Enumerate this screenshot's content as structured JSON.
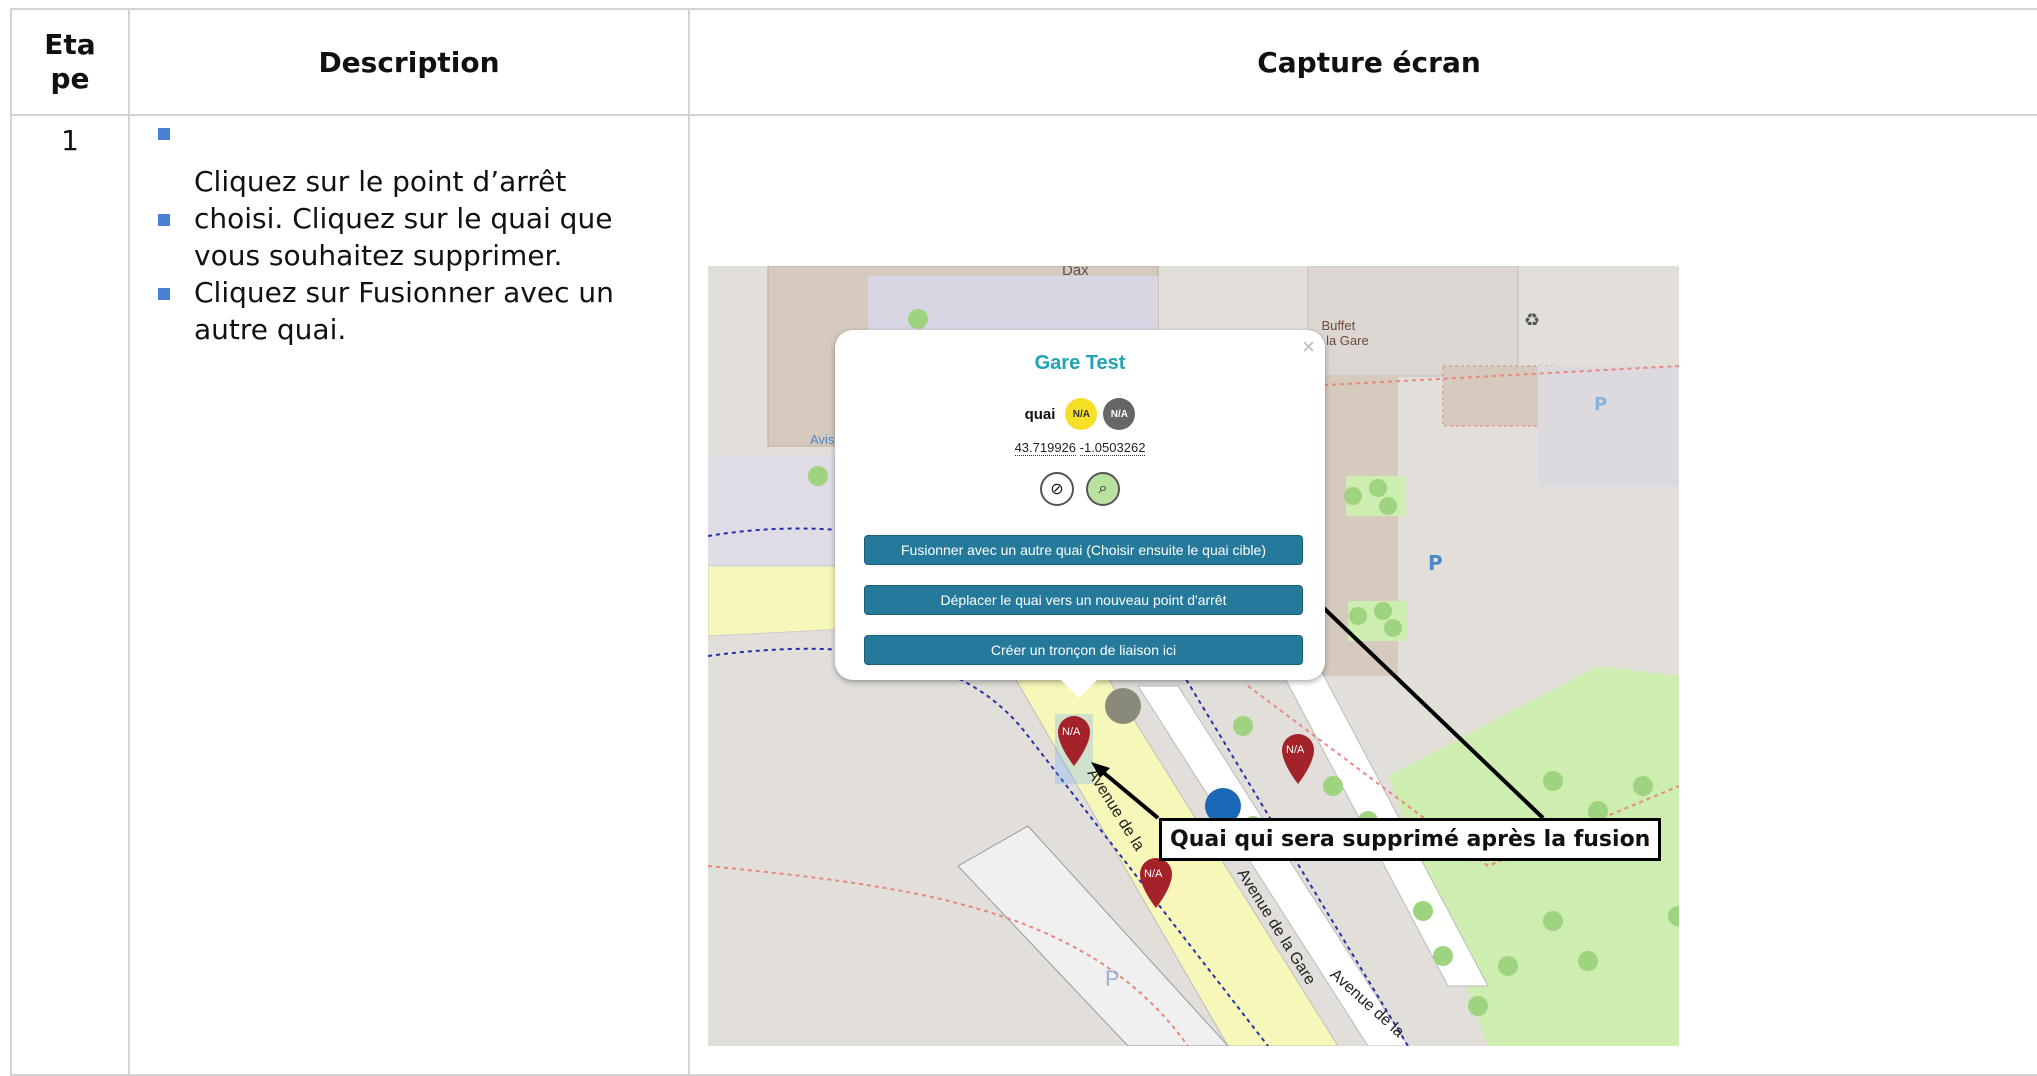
{
  "header": {
    "col_step": "Eta\npe",
    "col_description": "Description",
    "col_screenshot": "Capture écran"
  },
  "rows": [
    {
      "step": "1",
      "bullets": [
        "Cliquez sur le point d’arrêt",
        "choisi. Cliquez sur le quai que vous souhaitez supprimer.",
        "Cliquez sur Fusionner avec un autre quai."
      ]
    }
  ],
  "map": {
    "labels": {
      "dax": "Dax",
      "buffet": "Buffet\nde la Gare",
      "avis": "Avis",
      "street1": "Avenue de la",
      "street2": "Avenue de la Gare",
      "street3": "Avenue de la",
      "parking": "P"
    },
    "popup": {
      "title": "Gare Test",
      "close": "×",
      "quai_label": "quai",
      "badge1": "N/A",
      "badge2": "N/A",
      "lat": "43.719926",
      "lon": "-1.0503262",
      "btn_merge": "Fusionner avec un autre quai (Choisir ensuite le quai cible)",
      "btn_move": "Déplacer le quai vers un nouveau point d'arrêt",
      "btn_link": "Créer un tronçon de liaison ici"
    },
    "markers": [
      "N/A",
      "N/A",
      "N/A"
    ],
    "callout": "Quai qui sera supprimé après la fusion"
  },
  "colors": {
    "accent": "#257a9c",
    "title": "#20a3b5",
    "marker": "#a4232a",
    "bullet": "#4a7fd6"
  }
}
